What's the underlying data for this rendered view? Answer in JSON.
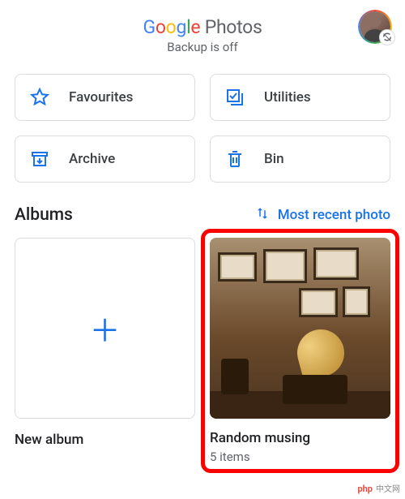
{
  "header": {
    "logo_text": "Google",
    "logo_suffix": "Photos",
    "backup_status": "Backup is off"
  },
  "tiles": {
    "favourites": "Favourites",
    "utilities": "Utilities",
    "archive": "Archive",
    "bin": "Bin"
  },
  "section": {
    "albums_title": "Albums",
    "sort_label": "Most recent photo"
  },
  "albums": {
    "new_label": "New album",
    "items": [
      {
        "title": "Random musing",
        "count": "5 items"
      }
    ]
  },
  "watermark": {
    "brand": "php",
    "suffix": "中文网"
  }
}
